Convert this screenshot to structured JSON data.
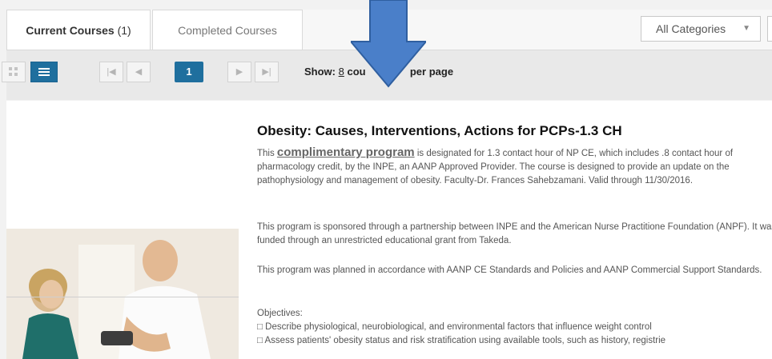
{
  "tabs": {
    "current_label": "Current Courses",
    "current_count": "(1)",
    "completed_label": "Completed Courses"
  },
  "filter": {
    "category_value": "All Categories"
  },
  "toolbar": {
    "grid_icon": "grid-view-icon",
    "list_icon": "list-view-icon",
    "first_icon": "first-page-icon",
    "prev_icon": "previous-page-icon",
    "next_icon": "next-page-icon",
    "last_icon": "last-page-icon",
    "current_page": "1",
    "show_prefix": "Show:",
    "per_page_value": "8",
    "show_middle": "cou",
    "show_suffix": "per page"
  },
  "course": {
    "title": "Obesity: Causes, Interventions, Actions for PCPs-1.3 CH",
    "intro_before": "This ",
    "intro_link": "complimentary program",
    "intro_after": " is designated for 1.3 contact hour of NP CE, which includes .8 contact hour of pharmacology credit, by the INPE, an AANP Approved Provider.  The course is designed to provide an update on the pathophysiology and management of obesity.  Faculty-Dr. Frances Sahebzamani. Valid through 11/30/2016.",
    "sponsor": "This program is sponsored through a partnership between INPE and the American Nurse Practitione Foundation (ANPF).  It was funded through an unrestricted educational grant from Takeda.",
    "standards": "This program was planned in accordance with AANP CE Standards and Policies and AANP Commercial Support Standards.",
    "objectives_heading": "Objectives:",
    "objective_1": "□ Describe physiological, neurobiological, and environmental factors that influence weight control",
    "objective_2": "□ Assess patients' obesity status and risk stratification using available tools, such as history, registrie"
  },
  "colors": {
    "accent": "#1f6f9e",
    "arrow": "#4a7fc9"
  }
}
